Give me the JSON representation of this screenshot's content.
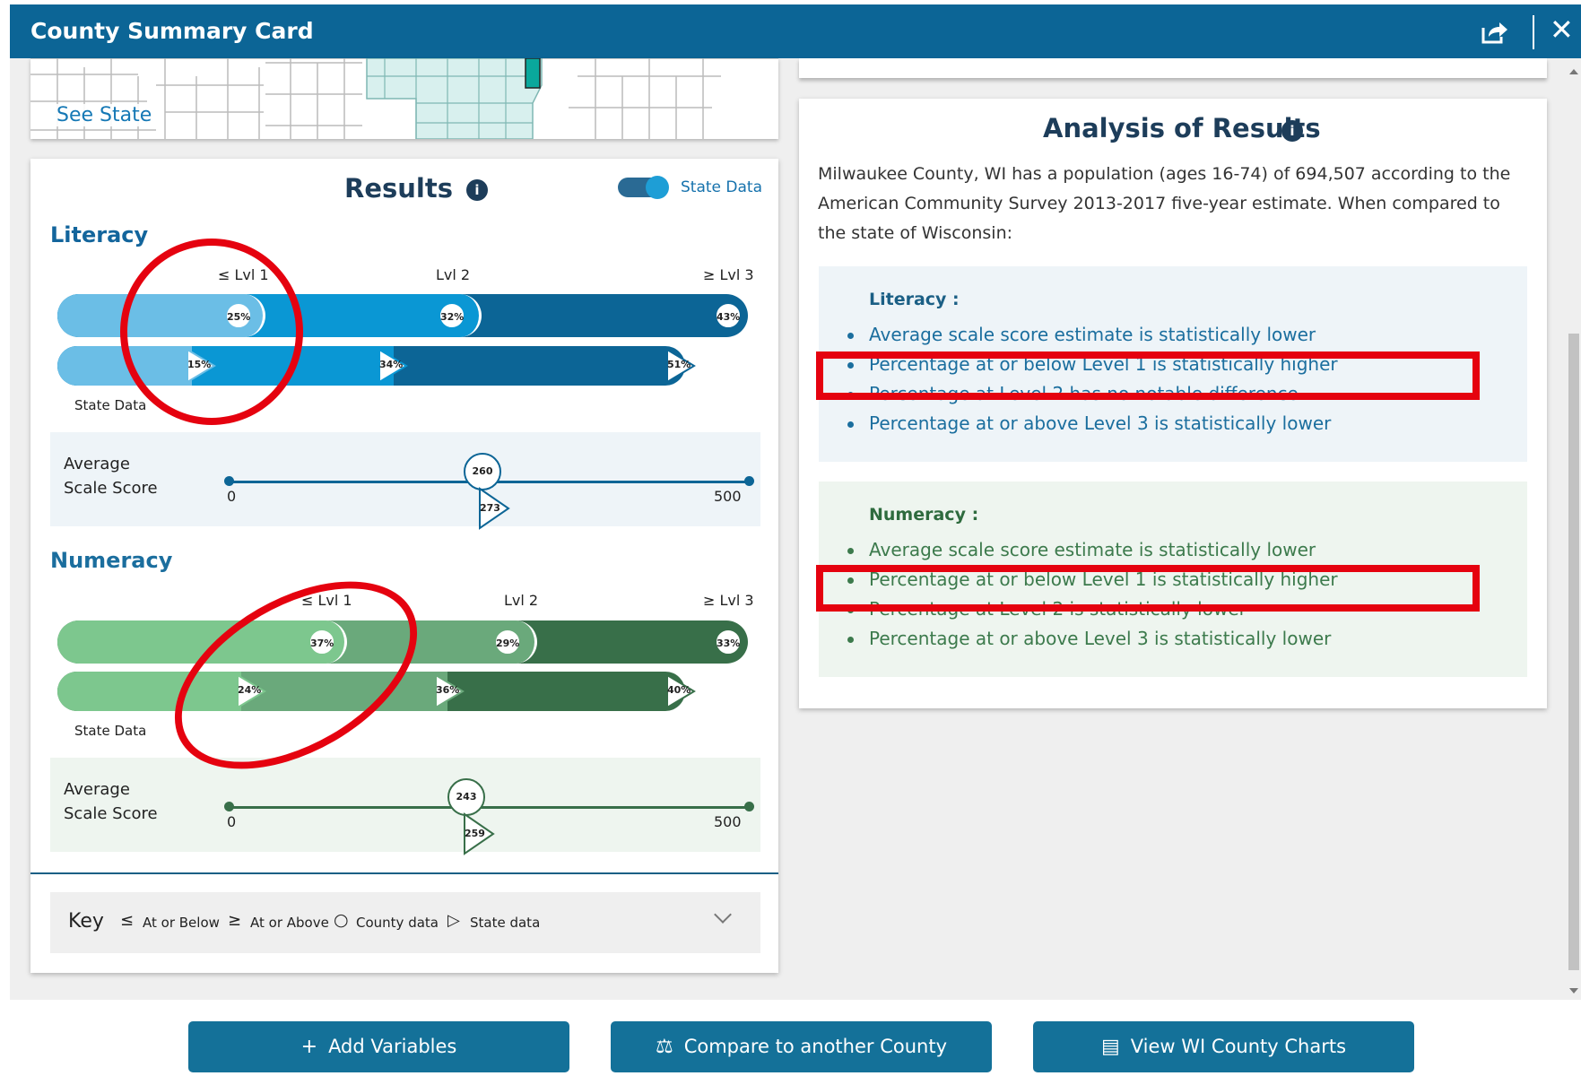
{
  "window": {
    "title": "County Summary Card",
    "share_icon": "share-icon",
    "close_glyph": "✕"
  },
  "map": {
    "see_state_link": "See State"
  },
  "results": {
    "title": "Results",
    "info_glyph": "i",
    "toggle_label": "State Data",
    "toggle_on": true,
    "literacy": {
      "title": "Literacy",
      "levels": [
        "≤ Lvl 1",
        "Lvl 2",
        "≥ Lvl 3"
      ],
      "county_pct": [
        "25%",
        "32%",
        "43%"
      ],
      "state_label": "State Data",
      "state_pct": [
        "15%",
        "34%",
        "51%"
      ],
      "score_label_1": "Average",
      "score_label_2": "Scale Score",
      "score_min": "0",
      "score_max": "500",
      "county_score": "260",
      "state_score": "273"
    },
    "numeracy": {
      "title": "Numeracy",
      "levels": [
        "≤ Lvl 1",
        "Lvl 2",
        "≥ Lvl 3"
      ],
      "county_pct": [
        "37%",
        "29%",
        "33%"
      ],
      "state_label": "State Data",
      "state_pct": [
        "24%",
        "36%",
        "40%"
      ],
      "score_label_1": "Average",
      "score_label_2": "Scale Score",
      "score_min": "0",
      "score_max": "500",
      "county_score": "243",
      "state_score": "259"
    },
    "key": {
      "title": "Key",
      "at_or_below_symbol": "≤",
      "at_or_below": "At or Below",
      "at_or_above_symbol": "≥",
      "at_or_above": "At or Above",
      "county_symbol": "○",
      "county": "County data",
      "state_symbol": "▷",
      "state": "State data"
    }
  },
  "analysis": {
    "title": "Analysis of Results",
    "info_glyph": "i",
    "intro": "Milwaukee County, WI has a population (ages 16-74) of 694,507 according to the American Community Survey 2013-2017 five-year estimate. When compared to the state of Wisconsin:",
    "literacy": {
      "title": "Literacy :",
      "items": [
        "Average scale score estimate is statistically lower",
        "Percentage at or below Level 1 is statistically higher",
        "Percentage at Level 2 has no notable difference",
        "Percentage at or above Level 3 is statistically lower"
      ]
    },
    "numeracy": {
      "title": "Numeracy :",
      "items": [
        "Average scale score estimate is statistically lower",
        "Percentage at or below Level 1 is statistically higher",
        "Percentage at Level 2 is statistically lower",
        "Percentage at or above Level 3 is statistically lower"
      ]
    }
  },
  "buttons": {
    "add_variables": "Add Variables",
    "add_glyph": "+",
    "compare": "Compare to another County",
    "compare_glyph": "⚖",
    "view_charts": "View WI County Charts",
    "charts_glyph": "▤"
  },
  "colors": {
    "header": "#0c6596",
    "literacy_dark": "#0c6596",
    "literacy_mid": "#0a97d4",
    "literacy_light": "#6bbee6",
    "numeracy_dark": "#386f49",
    "numeracy_mid": "#6aa97b",
    "numeracy_light": "#7dc78e",
    "annotation_red": "#e5020f"
  }
}
